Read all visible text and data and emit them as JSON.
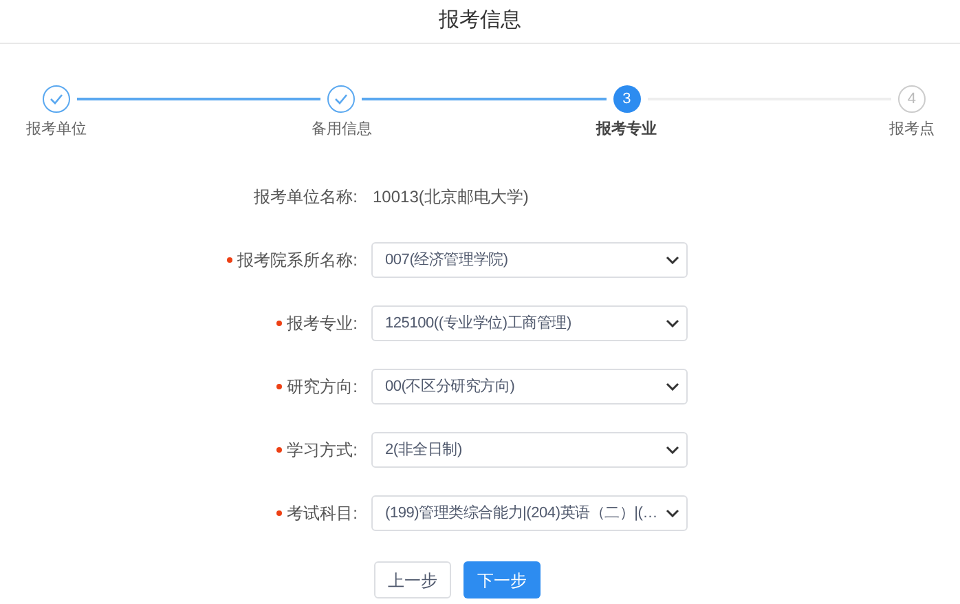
{
  "title": "报考信息",
  "steps": [
    {
      "label": "报考单位",
      "completed": true,
      "selected": false
    },
    {
      "label": "备用信息",
      "completed": true,
      "selected": false
    },
    {
      "label": "报考专业",
      "completed": false,
      "selected": true,
      "number": "3"
    },
    {
      "label": "报考点",
      "completed": false,
      "selected": false,
      "number": "4"
    }
  ],
  "fields": [
    {
      "kind": "text",
      "label": "报考单位名称:",
      "required": false,
      "value": "10013(北京邮电大学)"
    },
    {
      "kind": "select",
      "label": "报考院系所名称:",
      "required": true,
      "value": "007(经济管理学院)"
    },
    {
      "kind": "select",
      "label": "报考专业:",
      "required": true,
      "value": "125100((专业学位)工商管理)"
    },
    {
      "kind": "select",
      "label": "研究方向:",
      "required": true,
      "value": "00(不区分研究方向)"
    },
    {
      "kind": "select",
      "label": "学习方式:",
      "required": true,
      "value": "2(非全日制)"
    },
    {
      "kind": "select",
      "label": "考试科目:",
      "required": true,
      "value": "(199)管理类综合能力|(204)英语（二）|(…"
    }
  ],
  "buttons": [
    {
      "label": "上一步",
      "kind": "secondary"
    },
    {
      "label": "下一步",
      "kind": "primary"
    }
  ]
}
